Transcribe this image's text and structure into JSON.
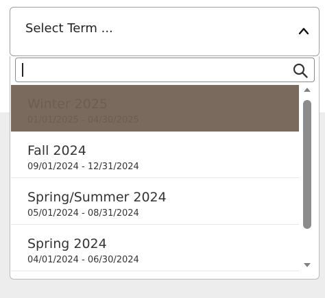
{
  "select": {
    "label": "Select Term ...",
    "expanded": true
  },
  "search": {
    "value": "",
    "placeholder": ""
  },
  "terms": [
    {
      "name": "Winter 2025",
      "dates": "01/01/2025 - 04/30/2025",
      "selected": true
    },
    {
      "name": "Fall 2024",
      "dates": "09/01/2024 - 12/31/2024",
      "selected": false
    },
    {
      "name": "Spring/Summer 2024",
      "dates": "05/01/2024 - 08/31/2024",
      "selected": false
    },
    {
      "name": "Spring 2024",
      "dates": "04/01/2024 - 06/30/2024",
      "selected": false
    }
  ],
  "icons": {
    "chevron": "chevron-up-icon",
    "search": "search-icon"
  },
  "colors": {
    "selected_background": "#7a6a5e",
    "selected_text": "#6c5d52",
    "text": "#333333"
  }
}
